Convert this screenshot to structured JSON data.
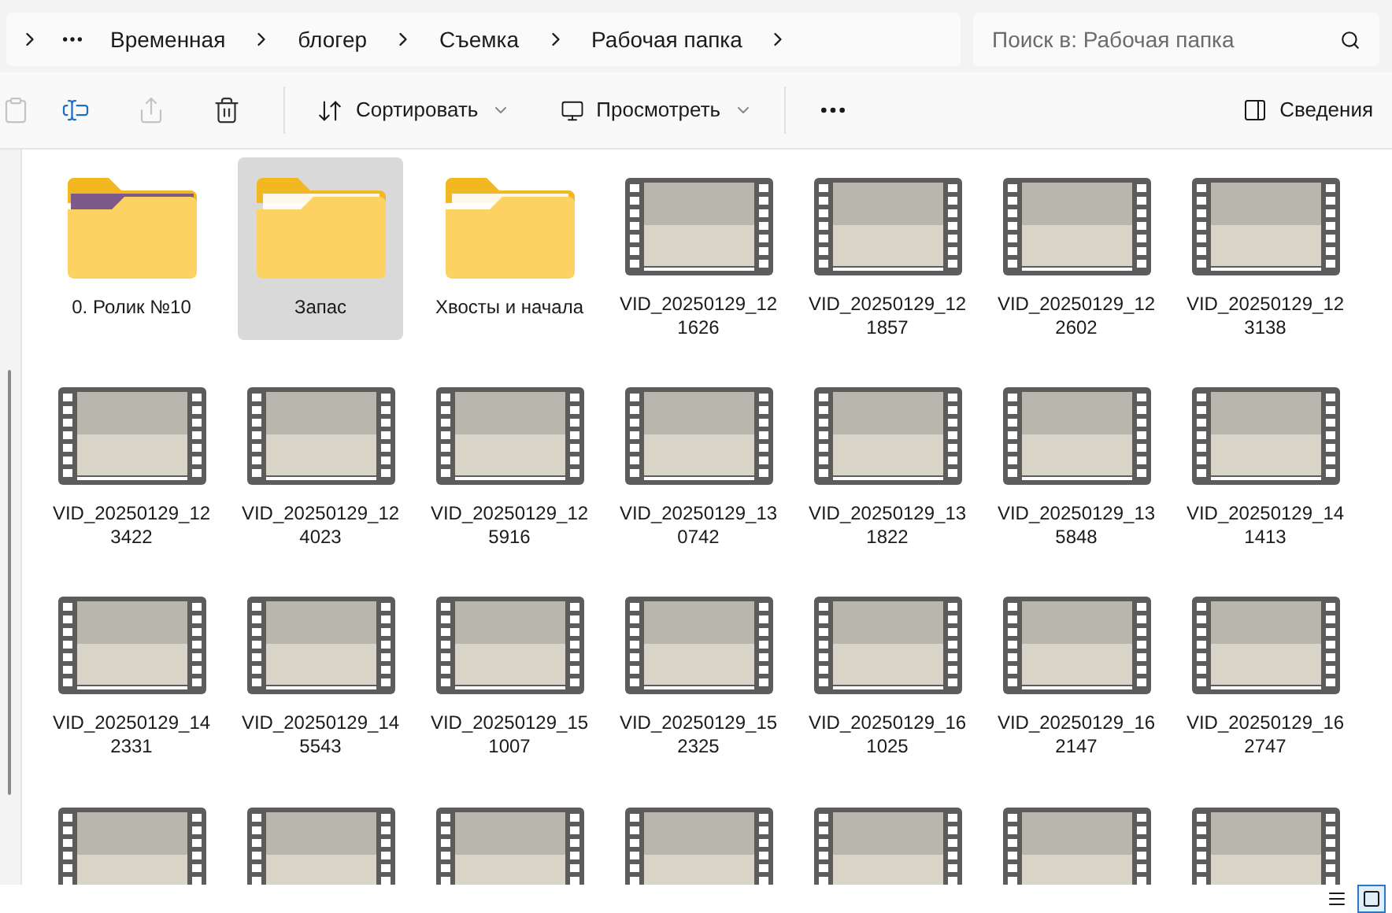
{
  "address_bar": {
    "path": [
      "Временная",
      "блогер",
      "Съемка",
      "Рабочая папка"
    ]
  },
  "search": {
    "placeholder": "Поиск в: Рабочая папка"
  },
  "toolbar": {
    "icon_buttons": [
      {
        "kind": "paste",
        "disabled": true
      },
      {
        "kind": "rename",
        "disabled": false
      },
      {
        "kind": "share",
        "disabled": true
      },
      {
        "kind": "delete",
        "disabled": false
      }
    ],
    "sort": {
      "label": "Сортировать"
    },
    "view": {
      "label": "Просмотреть"
    },
    "details": {
      "label": "Сведения"
    }
  },
  "items": [
    {
      "kind": "folder-photo",
      "name": "0. Ролик №10",
      "selected": false
    },
    {
      "kind": "folder",
      "name": "Запас",
      "selected": true
    },
    {
      "kind": "folder",
      "name": "Хвосты и начала",
      "selected": false
    },
    {
      "kind": "video",
      "name": "VID_20250129_121626",
      "selected": false
    },
    {
      "kind": "video",
      "name": "VID_20250129_121857",
      "selected": false
    },
    {
      "kind": "video",
      "name": "VID_20250129_122602",
      "selected": false
    },
    {
      "kind": "video",
      "name": "VID_20250129_123138",
      "selected": false
    },
    {
      "kind": "video",
      "name": "VID_20250129_123422",
      "selected": false
    },
    {
      "kind": "video",
      "name": "VID_20250129_124023",
      "selected": false
    },
    {
      "kind": "video",
      "name": "VID_20250129_125916",
      "selected": false
    },
    {
      "kind": "video",
      "name": "VID_20250129_130742",
      "selected": false
    },
    {
      "kind": "video",
      "name": "VID_20250129_131822",
      "selected": false
    },
    {
      "kind": "video",
      "name": "VID_20250129_135848",
      "selected": false
    },
    {
      "kind": "video",
      "name": "VID_20250129_141413",
      "selected": false
    },
    {
      "kind": "video",
      "name": "VID_20250129_142331",
      "selected": false
    },
    {
      "kind": "video",
      "name": "VID_20250129_145543",
      "selected": false
    },
    {
      "kind": "video",
      "name": "VID_20250129_151007",
      "selected": false
    },
    {
      "kind": "video",
      "name": "VID_20250129_152325",
      "selected": false
    },
    {
      "kind": "video",
      "name": "VID_20250129_161025",
      "selected": false
    },
    {
      "kind": "video",
      "name": "VID_20250129_162147",
      "selected": false
    },
    {
      "kind": "video",
      "name": "VID_20250129_162747",
      "selected": false
    },
    {
      "kind": "video",
      "selected": false
    },
    {
      "kind": "video",
      "selected": false
    },
    {
      "kind": "video",
      "selected": false
    },
    {
      "kind": "video",
      "selected": false
    },
    {
      "kind": "video",
      "selected": false
    },
    {
      "kind": "video",
      "selected": false
    },
    {
      "kind": "video",
      "selected": false
    }
  ],
  "status_bar": {
    "views": [
      {
        "kind": "details",
        "selected": false
      },
      {
        "kind": "tiles",
        "selected": true
      }
    ]
  }
}
